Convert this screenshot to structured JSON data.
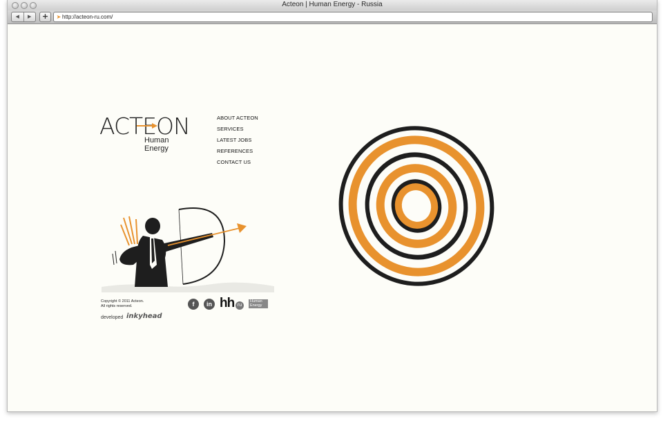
{
  "window": {
    "title": "Acteon | Human Energy - Russia"
  },
  "toolbar": {
    "back_icon": "back-arrow-icon",
    "forward_icon": "forward-arrow-icon",
    "add_label": "+",
    "url": "http://acteon-ru.com/"
  },
  "logo": {
    "name": "ACTEON",
    "tagline": "Human Energy"
  },
  "nav": {
    "items": [
      {
        "label": "ABOUT ACTEON"
      },
      {
        "label": "SERVICES"
      },
      {
        "label": "LATEST JOBS"
      },
      {
        "label": "REFERENCES"
      },
      {
        "label": "CONTACT US"
      }
    ]
  },
  "footer": {
    "copyright_line1": "Copyright © 2011 Acteon.",
    "copyright_line2": "All rights reserved.",
    "developed_label": "developed",
    "developer_name": "inkyhead",
    "social": {
      "facebook": "f",
      "linkedin": "in",
      "hh": "hh",
      "hh_ru": "ru",
      "human_energy_line1": "Human",
      "human_energy_line2": "Energy"
    }
  },
  "colors": {
    "accent": "#e8922e",
    "ink": "#1e1e1e",
    "background": "#fdfdf8"
  }
}
